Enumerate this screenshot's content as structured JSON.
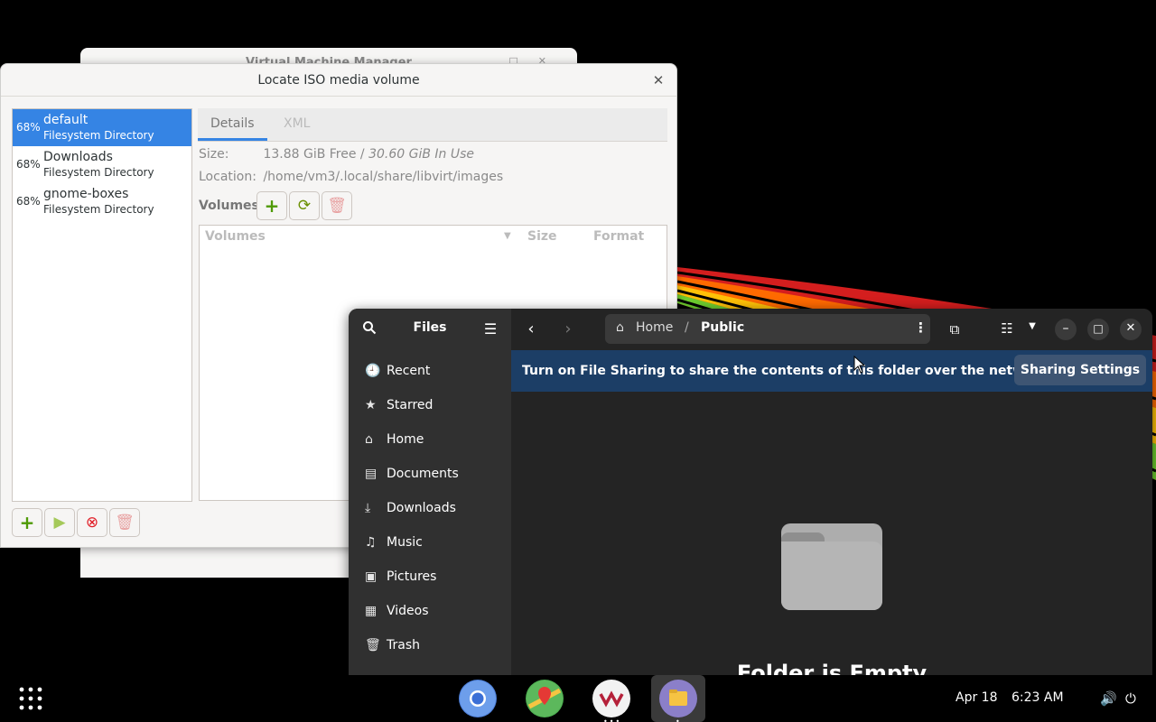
{
  "background_window": {
    "title": "Virtual Machine Manager"
  },
  "dialog": {
    "title": "Locate ISO media volume",
    "pools": [
      {
        "percent": "68%",
        "name": "default",
        "type": "Filesystem Directory"
      },
      {
        "percent": "68%",
        "name": "Downloads",
        "type": "Filesystem Directory"
      },
      {
        "percent": "68%",
        "name": "gnome-boxes",
        "type": "Filesystem Directory"
      }
    ],
    "tabs": [
      "Details",
      "XML"
    ],
    "size_label": "Size:",
    "size_free": "13.88 GiB Free /",
    "size_inuse": "30.60 GiB In Use",
    "location_label": "Location:",
    "location_value": "/home/vm3/.local/share/libvirt/images",
    "volumes_label": "Volumes",
    "columns": [
      "Volumes",
      "Size",
      "Format"
    ]
  },
  "files": {
    "title": "Files",
    "breadcrumb": {
      "home": "Home",
      "separator": "/",
      "current": "Public"
    },
    "sidebar": [
      "Recent",
      "Starred",
      "Home",
      "Documents",
      "Downloads",
      "Music",
      "Pictures",
      "Videos",
      "Trash"
    ],
    "banner_text": "Turn on File Sharing to share the contents of this folder over the network",
    "banner_button": "Sharing Settings",
    "empty_text": "Folder is Empty"
  },
  "taskbar": {
    "date": "Apr 18",
    "time": "6:23 AM",
    "apps": [
      "chromium-icon",
      "maps-icon",
      "virt-manager-icon",
      "files-icon"
    ]
  },
  "colors": {
    "accent": "#3584e4",
    "banner": "#1c3e66",
    "dark_bg": "#242424"
  }
}
